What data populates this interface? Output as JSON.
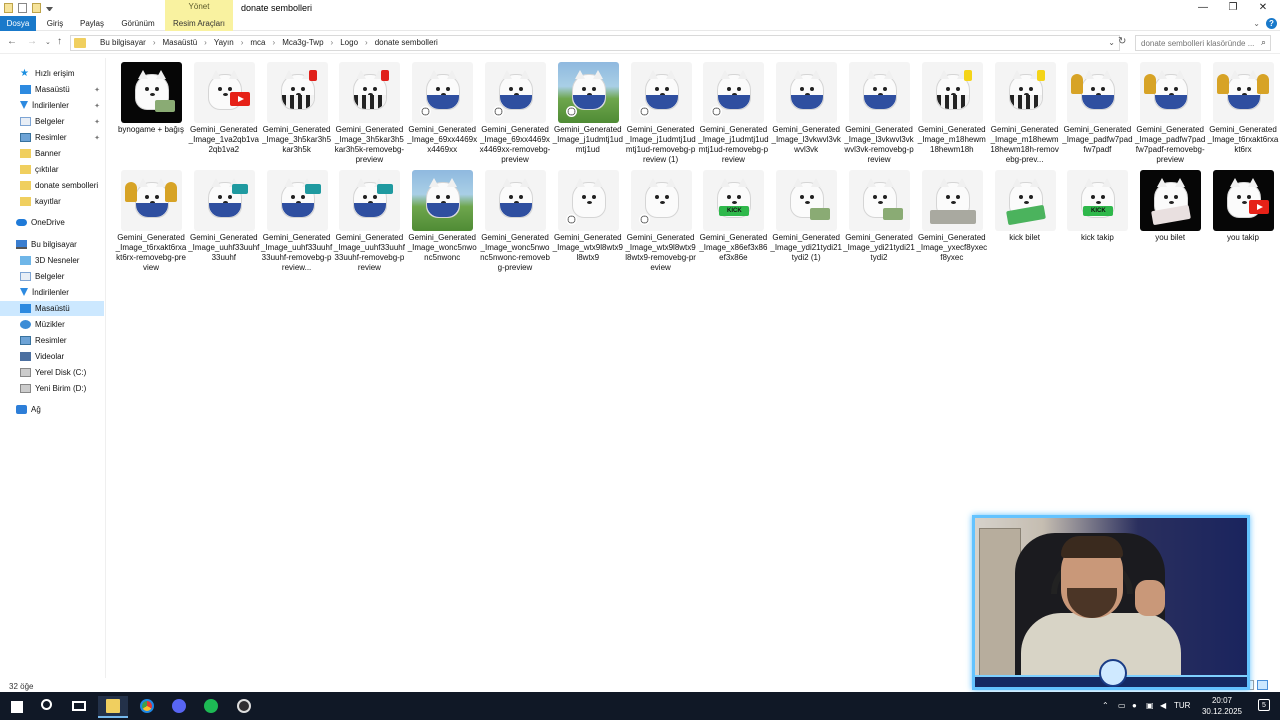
{
  "window": {
    "title": "donate sembolleri",
    "contextual_group": "Yönet",
    "minimize": "—",
    "maximize": "❐",
    "close": "✕"
  },
  "ribbon": {
    "tabs": [
      "Dosya",
      "Giriş",
      "Paylaş",
      "Görünüm",
      "Resim Araçları"
    ],
    "help": "?"
  },
  "address": {
    "breadcrumbs": [
      "Bu bilgisayar",
      "Masaüstü",
      "Yayın",
      "mca",
      "Mca3g-Twp",
      "Logo",
      "donate sembolleri"
    ],
    "separator": "›",
    "search_placeholder": "donate sembolleri klasöründe ..."
  },
  "navigation": {
    "items": [
      {
        "label": "Hızlı erişim",
        "icon": "star-icon"
      },
      {
        "label": "Masaüstü",
        "icon": "desktop-icon",
        "pinned": true
      },
      {
        "label": "İndirilenler",
        "icon": "download-icon",
        "pinned": true
      },
      {
        "label": "Belgeler",
        "icon": "documents-icon",
        "pinned": true
      },
      {
        "label": "Resimler",
        "icon": "pictures-icon",
        "pinned": true
      },
      {
        "label": "Banner",
        "icon": "folder-icon"
      },
      {
        "label": "çıktılar",
        "icon": "folder-icon"
      },
      {
        "label": "donate sembolleri",
        "icon": "folder-icon"
      },
      {
        "label": "kayıtlar",
        "icon": "folder-icon"
      },
      {
        "label": "OneDrive",
        "icon": "onedrive-icon"
      },
      {
        "label": "Bu bilgisayar",
        "icon": "this-pc-icon"
      },
      {
        "label": "3D Nesneler",
        "icon": "3d-objects-icon"
      },
      {
        "label": "Belgeler",
        "icon": "documents-icon"
      },
      {
        "label": "İndirilenler",
        "icon": "download-icon"
      },
      {
        "label": "Masaüstü",
        "icon": "desktop-icon",
        "selected": true
      },
      {
        "label": "Müzikler",
        "icon": "music-icon"
      },
      {
        "label": "Resimler",
        "icon": "pictures-icon"
      },
      {
        "label": "Videolar",
        "icon": "videos-icon"
      },
      {
        "label": "Yerel Disk (C:)",
        "icon": "drive-icon"
      },
      {
        "label": "Yeni Birim (D:)",
        "icon": "drive-icon"
      },
      {
        "label": "Ağ",
        "icon": "network-icon"
      }
    ]
  },
  "files": [
    {
      "name": "bynogame + bağış",
      "thumb": "dark",
      "prop": "money"
    },
    {
      "name": "Gemini_Generated_Image_1va2qb1va2qb1va2",
      "thumb": "plain",
      "prop": "youtube"
    },
    {
      "name": "Gemini_Generated_Image_3h5kar3h5kar3h5k",
      "thumb": "referee",
      "prop": "red-card"
    },
    {
      "name": "Gemini_Generated_Image_3h5kar3h5kar3h5k-removebg-preview",
      "thumb": "referee",
      "prop": "red-card"
    },
    {
      "name": "Gemini_Generated_Image_69xx4469xx4469xx",
      "thumb": "blue",
      "prop": "ball"
    },
    {
      "name": "Gemini_Generated_Image_69xx4469xx4469xx-removebg-preview",
      "thumb": "blue",
      "prop": "ball"
    },
    {
      "name": "Gemini_Generated_Image_j1udmtj1udmtj1ud",
      "thumb": "green",
      "prop": "ball"
    },
    {
      "name": "Gemini_Generated_Image_j1udmtj1udmtj1ud-removebg-preview (1)",
      "thumb": "blue",
      "prop": "ball"
    },
    {
      "name": "Gemini_Generated_Image_j1udmtj1udmtj1ud-removebg-preview",
      "thumb": "blue",
      "prop": "ball"
    },
    {
      "name": "Gemini_Generated_Image_l3vkwvl3vkwvl3vk",
      "thumb": "blue",
      "prop": "none"
    },
    {
      "name": "Gemini_Generated_Image_l3vkwvl3vkwvl3vk-removebg-preview",
      "thumb": "blue",
      "prop": "none"
    },
    {
      "name": "Gemini_Generated_Image_m18hewm18hewm18h",
      "thumb": "referee",
      "prop": "yellow-card"
    },
    {
      "name": "Gemini_Generated_Image_m18hewm18hewm18h-removebg-prev...",
      "thumb": "referee",
      "prop": "yellow-card"
    },
    {
      "name": "Gemini_Generated_Image_padfw7padfw7padf",
      "thumb": "blue",
      "prop": "trophy"
    },
    {
      "name": "Gemini_Generated_Image_padfw7padfw7padf-removebg-preview",
      "thumb": "blue",
      "prop": "trophy"
    },
    {
      "name": "Gemini_Generated_Image_t6rxakt6rxakt6rx",
      "thumb": "blue",
      "prop": "trophies"
    },
    {
      "name": "Gemini_Generated_Image_t6rxakt6rxakt6rx-removebg-preview",
      "thumb": "blue",
      "prop": "trophies"
    },
    {
      "name": "Gemini_Generated_Image_uuhf33uuhf33uuhf",
      "thumb": "blue",
      "prop": "megaphone"
    },
    {
      "name": "Gemini_Generated_Image_uuhf33uuhf33uuhf-removebg-preview...",
      "thumb": "blue",
      "prop": "megaphone"
    },
    {
      "name": "Gemini_Generated_Image_uuhf33uuhf33uuhf-removebg-preview",
      "thumb": "blue",
      "prop": "megaphone"
    },
    {
      "name": "Gemini_Generated_Image_wonc5nwonc5nwonc",
      "thumb": "green",
      "prop": "none"
    },
    {
      "name": "Gemini_Generated_Image_wonc5nwonc5nwonc-removebg-preview",
      "thumb": "blue",
      "prop": "none"
    },
    {
      "name": "Gemini_Generated_Image_wtx9l8wtx9l8wtx9",
      "thumb": "plain-none",
      "prop": "ball"
    },
    {
      "name": "Gemini_Generated_Image_wtx9l8wtx9l8wtx9-removebg-preview",
      "thumb": "plain-none",
      "prop": "ball"
    },
    {
      "name": "Gemini_Generated_Image_x86ef3x86ef3x86e",
      "thumb": "plain-none",
      "prop": "kick"
    },
    {
      "name": "Gemini_Generated_Image_ydi21tydi21tydi2 (1)",
      "thumb": "plain-none",
      "prop": "money"
    },
    {
      "name": "Gemini_Generated_Image_ydi21tydi21tydi2",
      "thumb": "plain-none",
      "prop": "money"
    },
    {
      "name": "Gemini_Generated_Image_yxecf8yxecf8yxec",
      "thumb": "plain-none",
      "prop": "money-pile"
    },
    {
      "name": "kick bilet",
      "thumb": "plain-none",
      "prop": "kick-ticket"
    },
    {
      "name": "kick takip",
      "thumb": "plain-none",
      "prop": "kick"
    },
    {
      "name": "you bilet",
      "thumb": "dark",
      "prop": "ticket"
    },
    {
      "name": "you takip",
      "thumb": "dark",
      "prop": "youtube"
    }
  ],
  "status": {
    "item_count": "32 öğe"
  },
  "taskbar": {
    "apps": [
      "start-icon",
      "search-icon",
      "task-view-icon",
      "file-explorer-icon",
      "chrome-icon",
      "discord-icon",
      "spotify-icon",
      "obs-icon"
    ],
    "language": "TUR",
    "time": "20:07",
    "date": "30.12.2025",
    "notifications": "5"
  },
  "colors": {
    "accent": "#1979ca",
    "selection": "#cce8ff",
    "context_tab": "#f9f2a0",
    "taskbar": "#101826",
    "webcam_border": "#63c3ff"
  }
}
